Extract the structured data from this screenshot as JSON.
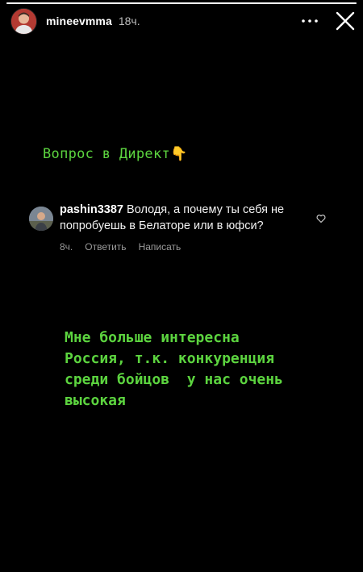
{
  "story": {
    "progress": 1.0,
    "username": "mineevmma",
    "time_ago": "18ч.",
    "icons": {
      "avatar": "user-avatar",
      "more": "more-dots-icon",
      "close": "close-icon"
    }
  },
  "question_title": "Вопрос в Директ",
  "question_emoji": "👇",
  "comment": {
    "username": "pashin3387",
    "text": "Володя, а почему ты себя не попробуешь в Белаторе или в юфси?",
    "time": "8ч.",
    "reply_label": "Ответить",
    "message_label": "Написать"
  },
  "answer_text": "Мне больше интересна\nРоссия, т.к. конкуренция\nсреди бойцов  у нас очень\nвысокая",
  "colors": {
    "accent_green": "#5cd43f",
    "background": "#000000"
  }
}
